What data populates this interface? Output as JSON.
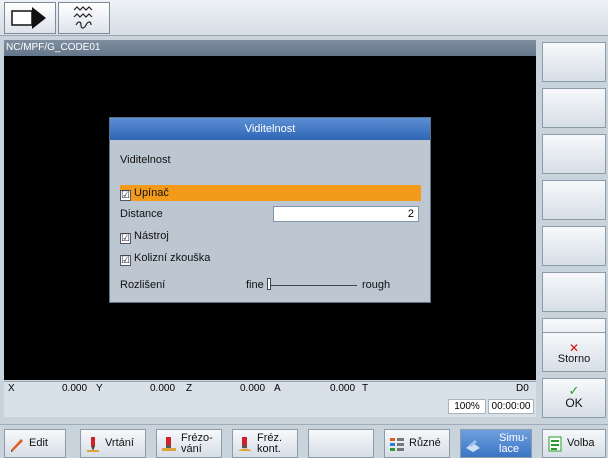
{
  "header": {
    "path": "NC/MPF/G_CODE01"
  },
  "dialog": {
    "title": "Viditelnost",
    "heading": "Viditelnost",
    "rows": {
      "upinac": "Upínač",
      "distance_label": "Distance",
      "distance_value": "2",
      "nastroj": "Nástroj",
      "kolizni": "Kolizní zkouška",
      "rozliseni_label": "Rozlišení",
      "fine": "fine",
      "rough": "rough"
    },
    "checkmark": "☑",
    "resolution_level": 0.0
  },
  "coords": {
    "x_label": "X",
    "x_value": "0.000",
    "y_label": "Y",
    "y_value": "0.000",
    "z_label": "Z",
    "z_value": "0.000",
    "a_label": "A",
    "a_value": "0.000",
    "t_label": "T",
    "d_value": "D0"
  },
  "status": {
    "percent": "100%",
    "time": "00:00:00"
  },
  "right_softkeys": {
    "storno": "Storno",
    "ok": "OK"
  },
  "bottom_softkeys": {
    "edit": "Edit",
    "vrtani": "Vrtání",
    "frezovani_1": "Frézo-",
    "frezovani_2": "vání",
    "frezkont_1": "Fréz.",
    "frezkont_2": "kont.",
    "ruzne": "Různé",
    "simulace_1": "Simu-",
    "simulace_2": "lace",
    "volba": "Volba"
  },
  "colors": {
    "highlight": "#f39a1b",
    "title_bar": "#2e66b5",
    "storno_x": "#d01010",
    "ok_check": "#2c9a2c"
  }
}
